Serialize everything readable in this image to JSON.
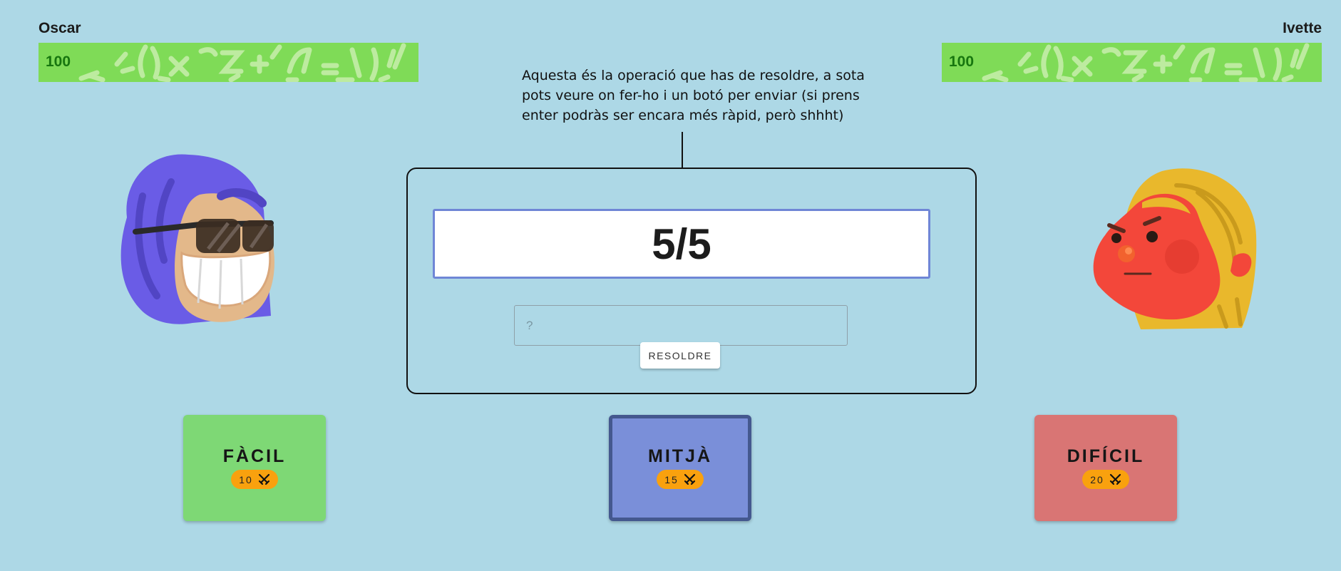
{
  "players": {
    "left": {
      "name": "Oscar",
      "hp": "100",
      "avatar": "sunglasses-avatar-icon"
    },
    "right": {
      "name": "Ivette",
      "hp": "100",
      "avatar": "angry-avatar-icon"
    }
  },
  "hint": {
    "text": "Aquesta és la operació que has de resoldre, a sota pots veure on fer-ho i un botó per enviar (si prens enter podràs ser encara més ràpid, però shhht)"
  },
  "game": {
    "operation": "5/5",
    "answer_placeholder": "?",
    "answer_value": "",
    "solve_label": "RESOLDRE"
  },
  "levels": [
    {
      "label": "FÀCIL",
      "points": "10",
      "color": "#7ed875",
      "selected": false
    },
    {
      "label": "MITJÀ",
      "points": "15",
      "color": "#7a8fd9",
      "selected": true
    },
    {
      "label": "DIFÍCIL",
      "points": "20",
      "color": "#d97574",
      "selected": false
    }
  ],
  "colors": {
    "background": "#add8e6",
    "hp_bar": "#7fdb57",
    "badge": "#f9a10e",
    "operation_border": "#6f86d6"
  },
  "icons": {
    "badge": "crossed-swords-icon"
  }
}
